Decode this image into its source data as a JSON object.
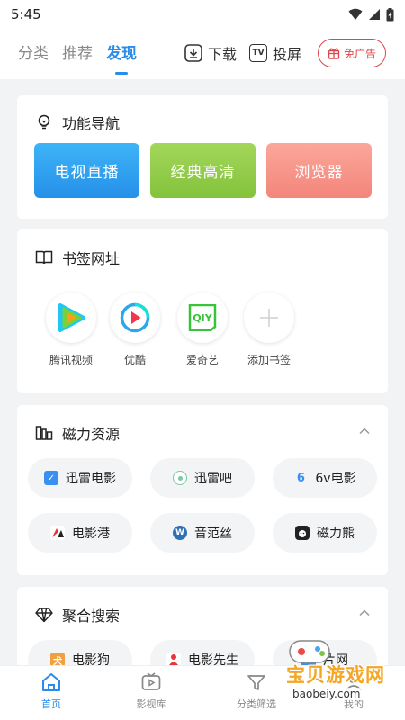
{
  "status_bar": {
    "time": "5:45"
  },
  "top_nav": {
    "tabs": [
      {
        "label": "分类"
      },
      {
        "label": "推荐"
      },
      {
        "label": "发现"
      }
    ],
    "download_label": "下载",
    "cast_label": "投屏",
    "ad_free_label": "免广告"
  },
  "func_nav": {
    "title": "功能导航",
    "buttons": [
      {
        "label": "电视直播"
      },
      {
        "label": "经典高清"
      },
      {
        "label": "浏览器"
      }
    ]
  },
  "bookmarks": {
    "title": "书签网址",
    "items": [
      {
        "label": "腾讯视频"
      },
      {
        "label": "优酷"
      },
      {
        "label": "爱奇艺"
      },
      {
        "label": "添加书签"
      }
    ]
  },
  "magnet": {
    "title": "磁力资源",
    "items": [
      {
        "label": "迅雷电影"
      },
      {
        "label": "迅雷吧"
      },
      {
        "label": "6v电影"
      },
      {
        "label": "电影港"
      },
      {
        "label": "音范丝"
      },
      {
        "label": "磁力熊"
      }
    ]
  },
  "aggregate": {
    "title": "聚合搜索",
    "items": [
      {
        "label": "电影狗"
      },
      {
        "label": "电影先生"
      },
      {
        "label": "片网"
      }
    ]
  },
  "bottom_nav": {
    "items": [
      {
        "label": "首页"
      },
      {
        "label": "影视库"
      },
      {
        "label": "分类筛选"
      },
      {
        "label": "我的"
      }
    ]
  },
  "watermark": {
    "text": "宝贝游戏网",
    "url": "baobeiy.com"
  },
  "colors": {
    "accent": "#2a8ce8",
    "tv_live": "#2f9fee",
    "classic_hd": "#92cc4a",
    "browser": "#f7928a",
    "ad_red": "#e0454a"
  }
}
